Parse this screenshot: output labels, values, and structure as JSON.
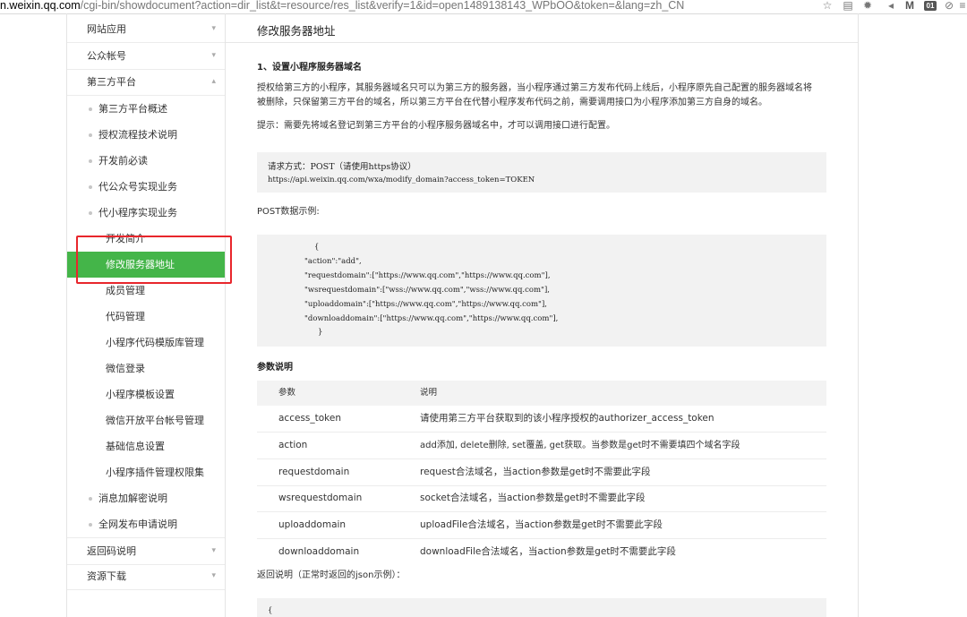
{
  "browser": {
    "url_host": "n.weixin.qq.com",
    "url_path": "/cgi-bin/showdocument?action=dir_list&t=resource/res_list&verify=1&id=open1489138143_WPbOO&token=&lang=zh_CN",
    "badge_count": "01"
  },
  "sidebar": {
    "items": [
      {
        "label": "网站应用",
        "chevron": "▾"
      },
      {
        "label": "公众帐号",
        "chevron": "▾"
      },
      {
        "label": "第三方平台",
        "chevron": "▴"
      },
      {
        "label": "第三方平台概述"
      },
      {
        "label": "授权流程技术说明"
      },
      {
        "label": "开发前必读"
      },
      {
        "label": "代公众号实现业务"
      },
      {
        "label": "代小程序实现业务"
      },
      {
        "label": "开发简介"
      },
      {
        "label": "修改服务器地址"
      },
      {
        "label": "成员管理"
      },
      {
        "label": "代码管理"
      },
      {
        "label": "小程序代码模版库管理"
      },
      {
        "label": "微信登录"
      },
      {
        "label": "小程序模板设置"
      },
      {
        "label": "微信开放平台帐号管理"
      },
      {
        "label": "基础信息设置"
      },
      {
        "label": "小程序插件管理权限集"
      },
      {
        "label": "消息加解密说明"
      },
      {
        "label": "全网发布申请说明"
      },
      {
        "label": "返回码说明",
        "chevron": "▾"
      },
      {
        "label": "资源下载",
        "chevron": "▾"
      }
    ]
  },
  "main": {
    "title": "修改服务器地址",
    "section_heading": "1、设置小程序服务器域名",
    "para1_line1": "授权给第三方的小程序，其服务器域名只可以为第三方的服务器，当小程序通过第三方发布代码上线后，小程序原先自己配置的服务器域名将",
    "para1_line2": "被删除，只保留第三方平台的域名，所以第三方平台在代替小程序发布代码之前，需要调用接口为小程序添加第三方自身的域名。",
    "tip": "提示：需要先将域名登记到第三方平台的小程序服务器域名中，才可以调用接口进行配置。",
    "request_method": "请求方式：POST（请使用https协议）",
    "request_url": "https://api.weixin.qq.com/wxa/modify_domain?access_token=TOKEN",
    "post_label": "POST数据示例:",
    "post_example": [
      "{",
      "\"action\":\"add\",",
      "\"requestdomain\":[\"https://www.qq.com\",\"https://www.qq.com\"],",
      "\"wsrequestdomain\":[\"wss://www.qq.com\",\"wss://www.qq.com\"],",
      "\"uploaddomain\":[\"https://www.qq.com\",\"https://www.qq.com\"],",
      "\"downloaddomain\":[\"https://www.qq.com\",\"https://www.qq.com\"],",
      "}"
    ],
    "params_heading": "参数说明",
    "params_table": {
      "headers": [
        "参数",
        "说明"
      ],
      "rows": [
        [
          "access_token",
          "请使用第三方平台获取到的该小程序授权的authorizer_access_token"
        ],
        [
          "action",
          "add添加, delete删除, set覆盖, get获取。当参数是get时不需要填四个域名字段"
        ],
        [
          "requestdomain",
          "request合法域名，当action参数是get时不需要此字段"
        ],
        [
          "wsrequestdomain",
          "socket合法域名，当action参数是get时不需要此字段"
        ],
        [
          "uploaddomain",
          "uploadFile合法域名，当action参数是get时不需要此字段"
        ],
        [
          "downloaddomain",
          "downloadFile合法域名，当action参数是get时不需要此字段"
        ]
      ]
    },
    "return_label": "返回说明（正常时返回的json示例）：",
    "return_example_first_line": "{"
  }
}
